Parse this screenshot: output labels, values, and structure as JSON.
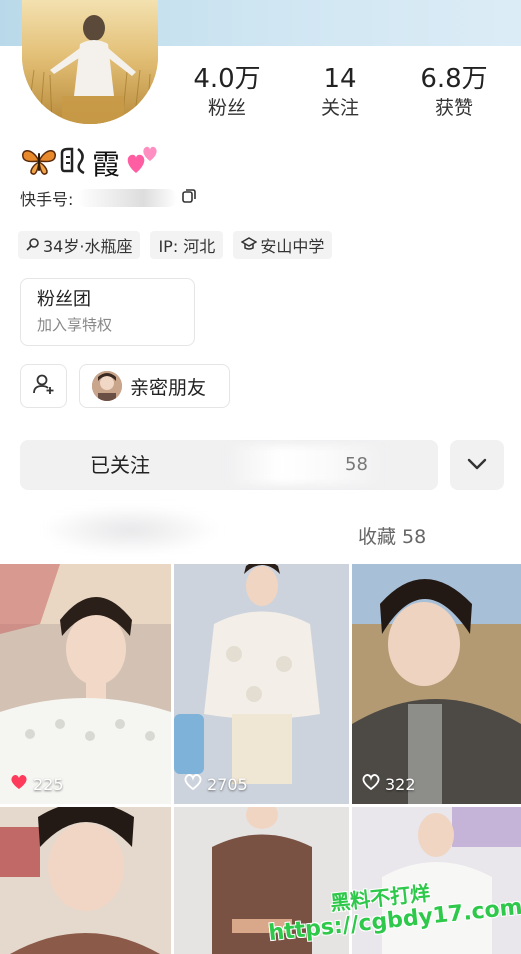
{
  "profile": {
    "name": "霞",
    "id_label": "快手号:",
    "stats": [
      {
        "value": "4.0万",
        "label": "粉丝"
      },
      {
        "value": "14",
        "label": "关注"
      },
      {
        "value": "6.8万",
        "label": "获赞"
      }
    ],
    "tags": [
      {
        "icon": "search-person-icon",
        "text": "34岁·水瓶座"
      },
      {
        "icon": "",
        "text": "IP: 河北"
      },
      {
        "icon": "graduation-cap-icon",
        "text": "安山中学"
      }
    ]
  },
  "fan_club": {
    "title": "粉丝团",
    "subtitle": "加入享特权"
  },
  "close_friends": {
    "label": "亲密朋友"
  },
  "actions": {
    "follow_label": "已关注",
    "follow_count": "58",
    "more_icon": "chevron-down-icon"
  },
  "tabs": {
    "favorites": "收藏 58"
  },
  "videos": [
    {
      "likes": "225",
      "liked": true
    },
    {
      "likes": "2705",
      "liked": false
    },
    {
      "likes": "322",
      "liked": false
    },
    {
      "likes": "",
      "liked": false
    },
    {
      "likes": "",
      "liked": false
    },
    {
      "likes": "",
      "liked": false
    }
  ],
  "watermark": {
    "line1": "黑料不打烊",
    "line2": "https://cgbdy17.com"
  },
  "colors": {
    "accent": "#ff3b5c",
    "watermark": "#2ec84a",
    "card_bg": "#f1f1f2"
  }
}
